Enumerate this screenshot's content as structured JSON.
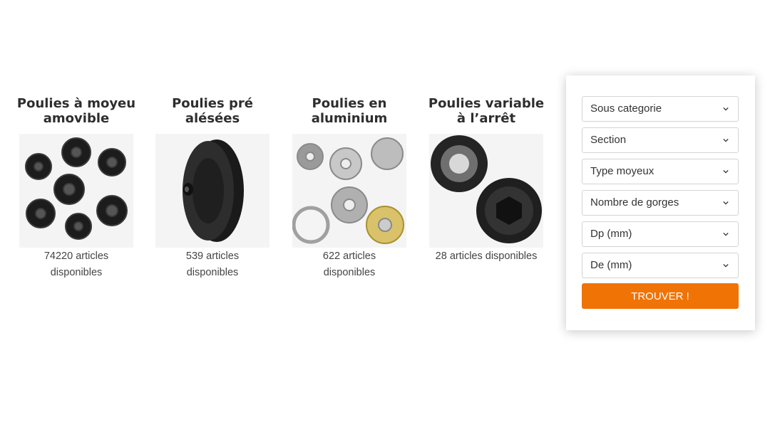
{
  "categories": [
    {
      "title": "Poulies à moyeu amovible",
      "count": "74220 articles disponibles",
      "image": "pulleys-assortment-image"
    },
    {
      "title": "Poulies pré alésées",
      "count": "539 articles disponibles",
      "image": "single-pulley-image"
    },
    {
      "title": "Poulies en aluminium",
      "count": "622 articles disponibles",
      "image": "aluminium-pulleys-image"
    },
    {
      "title": "Poulies variable à l’arrêt",
      "count": "28 articles disponibles",
      "image": "variable-pulleys-image"
    }
  ],
  "filters": {
    "selects": [
      {
        "label": "Sous categorie"
      },
      {
        "label": "Section"
      },
      {
        "label": "Type moyeux"
      },
      {
        "label": "Nombre de gorges"
      },
      {
        "label": "Dp (mm)"
      },
      {
        "label": "De (mm)"
      }
    ],
    "button_label": "TROUVER !",
    "button_color": "#f07306",
    "chevron_icon": "chevron-down-icon"
  }
}
